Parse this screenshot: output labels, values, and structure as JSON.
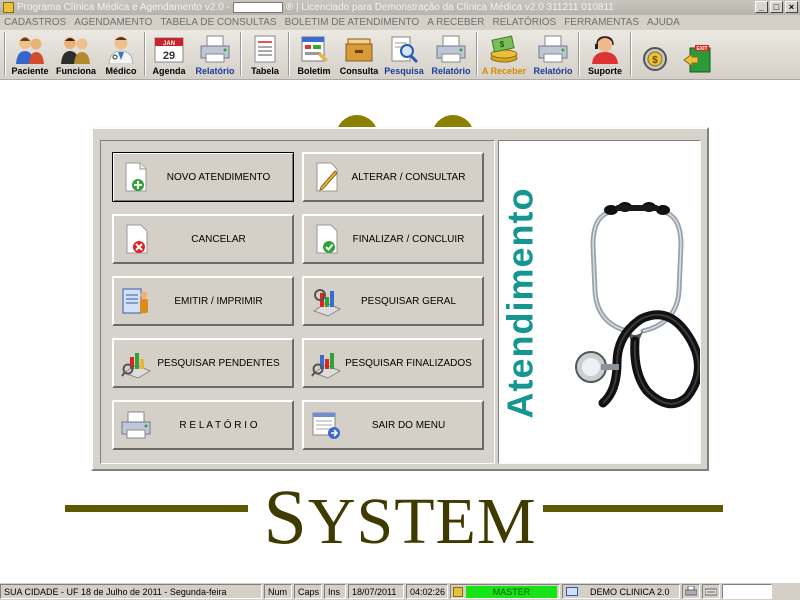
{
  "window": {
    "title_prefix": "Programa Clínica Médica e Agendamento v2.0 -",
    "title_suffix": "® | Licenciado para  Demonstração da Clínica Médica v2.0 311211 010811",
    "min_label": "_",
    "max_label": "□",
    "close_label": "×"
  },
  "menu": [
    "CADASTROS",
    "AGENDAMENTO",
    "TABELA DE CONSULTAS",
    "BOLETIM DE ATENDIMENTO",
    "A RECEBER",
    "RELATÓRIOS",
    "FERRAMENTAS",
    "AJUDA"
  ],
  "toolbar": {
    "paciente": "Paciente",
    "funciona": "Funciona",
    "medico": "Médico",
    "agenda": "Agenda",
    "calendar_month": "JAN",
    "calendar_day": "29",
    "relatorio1": "Relatório",
    "tabela": "Tabela",
    "boletim": "Boletim",
    "consulta": "Consulta",
    "pesquisa": "Pesquisa",
    "relatorio2": "Relatório",
    "areceber": "A Receber",
    "relatorio3": "Relatório",
    "suporte": "Suporte",
    "exit_sign": "EXIT"
  },
  "buttons": {
    "novo": "NOVO ATENDIMENTO",
    "alterar": "ALTERAR  /  CONSULTAR",
    "cancelar": "CANCELAR",
    "finalizar": "FINALIZAR  /  CONCLUIR",
    "emitir": "EMITIR  /  IMPRIMIR",
    "pesquisar_geral": "PESQUISAR GERAL",
    "pendentes": "PESQUISAR PENDENTES",
    "finalizados": "PESQUISAR FINALIZADOS",
    "relatorio": "R E L A T Ó R I O",
    "sair": "SAIR DO MENU"
  },
  "panel_title": "Atendimento",
  "brand": {
    "first": "S",
    "rest": "YSTEM"
  },
  "status": {
    "location": "SUA CIDADE - UF 18 de Julho de 2011 - Segunda-feira",
    "num": "Num",
    "caps": "Caps",
    "ins": "Ins",
    "date": "18/07/2011",
    "time": "04:02:26",
    "user": "MASTER",
    "company": "DEMO CLINICA 2.0"
  },
  "colors": {
    "accent_teal": "#159690",
    "brand_olive": "#3f3a00",
    "status_green": "#17e317"
  }
}
